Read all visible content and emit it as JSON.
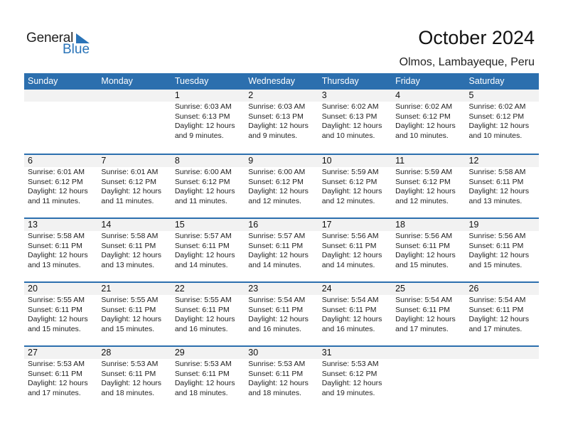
{
  "logo": {
    "general": "General",
    "blue": "Blue"
  },
  "header": {
    "title": "October 2024",
    "location": "Olmos, Lambayeque, Peru"
  },
  "colors": {
    "accent": "#2c6fae",
    "daynum_bg": "#f2f2f2"
  },
  "weekdays": [
    "Sunday",
    "Monday",
    "Tuesday",
    "Wednesday",
    "Thursday",
    "Friday",
    "Saturday"
  ],
  "weeks": [
    [
      {
        "day": "",
        "sunrise": "",
        "sunset": "",
        "daylight": "",
        "minutes": ""
      },
      {
        "day": "",
        "sunrise": "",
        "sunset": "",
        "daylight": "",
        "minutes": ""
      },
      {
        "day": "1",
        "sunrise": "Sunrise: 6:03 AM",
        "sunset": "Sunset: 6:13 PM",
        "daylight": "Daylight: 12 hours",
        "minutes": "and 9 minutes."
      },
      {
        "day": "2",
        "sunrise": "Sunrise: 6:03 AM",
        "sunset": "Sunset: 6:13 PM",
        "daylight": "Daylight: 12 hours",
        "minutes": "and 9 minutes."
      },
      {
        "day": "3",
        "sunrise": "Sunrise: 6:02 AM",
        "sunset": "Sunset: 6:13 PM",
        "daylight": "Daylight: 12 hours",
        "minutes": "and 10 minutes."
      },
      {
        "day": "4",
        "sunrise": "Sunrise: 6:02 AM",
        "sunset": "Sunset: 6:12 PM",
        "daylight": "Daylight: 12 hours",
        "minutes": "and 10 minutes."
      },
      {
        "day": "5",
        "sunrise": "Sunrise: 6:02 AM",
        "sunset": "Sunset: 6:12 PM",
        "daylight": "Daylight: 12 hours",
        "minutes": "and 10 minutes."
      }
    ],
    [
      {
        "day": "6",
        "sunrise": "Sunrise: 6:01 AM",
        "sunset": "Sunset: 6:12 PM",
        "daylight": "Daylight: 12 hours",
        "minutes": "and 11 minutes."
      },
      {
        "day": "7",
        "sunrise": "Sunrise: 6:01 AM",
        "sunset": "Sunset: 6:12 PM",
        "daylight": "Daylight: 12 hours",
        "minutes": "and 11 minutes."
      },
      {
        "day": "8",
        "sunrise": "Sunrise: 6:00 AM",
        "sunset": "Sunset: 6:12 PM",
        "daylight": "Daylight: 12 hours",
        "minutes": "and 11 minutes."
      },
      {
        "day": "9",
        "sunrise": "Sunrise: 6:00 AM",
        "sunset": "Sunset: 6:12 PM",
        "daylight": "Daylight: 12 hours",
        "minutes": "and 12 minutes."
      },
      {
        "day": "10",
        "sunrise": "Sunrise: 5:59 AM",
        "sunset": "Sunset: 6:12 PM",
        "daylight": "Daylight: 12 hours",
        "minutes": "and 12 minutes."
      },
      {
        "day": "11",
        "sunrise": "Sunrise: 5:59 AM",
        "sunset": "Sunset: 6:12 PM",
        "daylight": "Daylight: 12 hours",
        "minutes": "and 12 minutes."
      },
      {
        "day": "12",
        "sunrise": "Sunrise: 5:58 AM",
        "sunset": "Sunset: 6:11 PM",
        "daylight": "Daylight: 12 hours",
        "minutes": "and 13 minutes."
      }
    ],
    [
      {
        "day": "13",
        "sunrise": "Sunrise: 5:58 AM",
        "sunset": "Sunset: 6:11 PM",
        "daylight": "Daylight: 12 hours",
        "minutes": "and 13 minutes."
      },
      {
        "day": "14",
        "sunrise": "Sunrise: 5:58 AM",
        "sunset": "Sunset: 6:11 PM",
        "daylight": "Daylight: 12 hours",
        "minutes": "and 13 minutes."
      },
      {
        "day": "15",
        "sunrise": "Sunrise: 5:57 AM",
        "sunset": "Sunset: 6:11 PM",
        "daylight": "Daylight: 12 hours",
        "minutes": "and 14 minutes."
      },
      {
        "day": "16",
        "sunrise": "Sunrise: 5:57 AM",
        "sunset": "Sunset: 6:11 PM",
        "daylight": "Daylight: 12 hours",
        "minutes": "and 14 minutes."
      },
      {
        "day": "17",
        "sunrise": "Sunrise: 5:56 AM",
        "sunset": "Sunset: 6:11 PM",
        "daylight": "Daylight: 12 hours",
        "minutes": "and 14 minutes."
      },
      {
        "day": "18",
        "sunrise": "Sunrise: 5:56 AM",
        "sunset": "Sunset: 6:11 PM",
        "daylight": "Daylight: 12 hours",
        "minutes": "and 15 minutes."
      },
      {
        "day": "19",
        "sunrise": "Sunrise: 5:56 AM",
        "sunset": "Sunset: 6:11 PM",
        "daylight": "Daylight: 12 hours",
        "minutes": "and 15 minutes."
      }
    ],
    [
      {
        "day": "20",
        "sunrise": "Sunrise: 5:55 AM",
        "sunset": "Sunset: 6:11 PM",
        "daylight": "Daylight: 12 hours",
        "minutes": "and 15 minutes."
      },
      {
        "day": "21",
        "sunrise": "Sunrise: 5:55 AM",
        "sunset": "Sunset: 6:11 PM",
        "daylight": "Daylight: 12 hours",
        "minutes": "and 15 minutes."
      },
      {
        "day": "22",
        "sunrise": "Sunrise: 5:55 AM",
        "sunset": "Sunset: 6:11 PM",
        "daylight": "Daylight: 12 hours",
        "minutes": "and 16 minutes."
      },
      {
        "day": "23",
        "sunrise": "Sunrise: 5:54 AM",
        "sunset": "Sunset: 6:11 PM",
        "daylight": "Daylight: 12 hours",
        "minutes": "and 16 minutes."
      },
      {
        "day": "24",
        "sunrise": "Sunrise: 5:54 AM",
        "sunset": "Sunset: 6:11 PM",
        "daylight": "Daylight: 12 hours",
        "minutes": "and 16 minutes."
      },
      {
        "day": "25",
        "sunrise": "Sunrise: 5:54 AM",
        "sunset": "Sunset: 6:11 PM",
        "daylight": "Daylight: 12 hours",
        "minutes": "and 17 minutes."
      },
      {
        "day": "26",
        "sunrise": "Sunrise: 5:54 AM",
        "sunset": "Sunset: 6:11 PM",
        "daylight": "Daylight: 12 hours",
        "minutes": "and 17 minutes."
      }
    ],
    [
      {
        "day": "27",
        "sunrise": "Sunrise: 5:53 AM",
        "sunset": "Sunset: 6:11 PM",
        "daylight": "Daylight: 12 hours",
        "minutes": "and 17 minutes."
      },
      {
        "day": "28",
        "sunrise": "Sunrise: 5:53 AM",
        "sunset": "Sunset: 6:11 PM",
        "daylight": "Daylight: 12 hours",
        "minutes": "and 18 minutes."
      },
      {
        "day": "29",
        "sunrise": "Sunrise: 5:53 AM",
        "sunset": "Sunset: 6:11 PM",
        "daylight": "Daylight: 12 hours",
        "minutes": "and 18 minutes."
      },
      {
        "day": "30",
        "sunrise": "Sunrise: 5:53 AM",
        "sunset": "Sunset: 6:11 PM",
        "daylight": "Daylight: 12 hours",
        "minutes": "and 18 minutes."
      },
      {
        "day": "31",
        "sunrise": "Sunrise: 5:53 AM",
        "sunset": "Sunset: 6:12 PM",
        "daylight": "Daylight: 12 hours",
        "minutes": "and 19 minutes."
      },
      {
        "day": "",
        "sunrise": "",
        "sunset": "",
        "daylight": "",
        "minutes": ""
      },
      {
        "day": "",
        "sunrise": "",
        "sunset": "",
        "daylight": "",
        "minutes": ""
      }
    ]
  ]
}
